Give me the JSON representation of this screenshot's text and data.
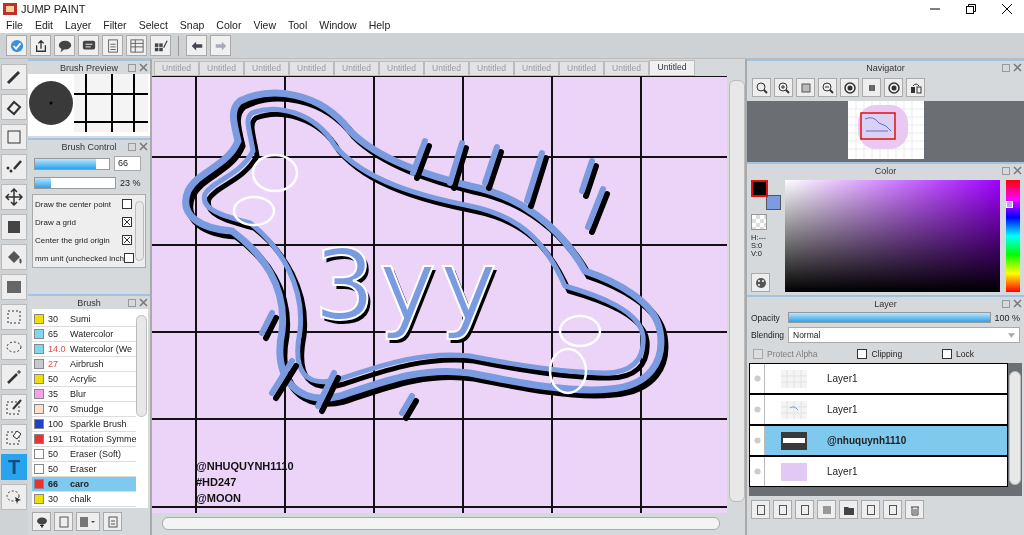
{
  "window": {
    "title": "JUMP PAINT"
  },
  "menu": [
    "File",
    "Edit",
    "Layer",
    "Filter",
    "Select",
    "Snap",
    "Color",
    "View",
    "Tool",
    "Window",
    "Help"
  ],
  "toolbar": [
    {
      "kind": "cloud"
    },
    {
      "kind": "share"
    },
    {
      "kind": "bubble"
    },
    {
      "kind": "comment"
    },
    {
      "kind": "page"
    },
    {
      "kind": "list"
    },
    {
      "kind": "grid"
    },
    {
      "kind": "undo"
    },
    {
      "kind": "redo"
    }
  ],
  "tools": [
    {
      "kind": "brush",
      "selected": false
    },
    {
      "kind": "eraser",
      "selected": false
    },
    {
      "kind": "square",
      "selected": false
    },
    {
      "kind": "dotpen",
      "selected": false
    },
    {
      "kind": "move",
      "selected": false
    },
    {
      "kind": "fill",
      "selected": false
    },
    {
      "kind": "bucket",
      "selected": false
    },
    {
      "kind": "gradient",
      "selected": false
    },
    {
      "kind": "rectselect",
      "selected": false
    },
    {
      "kind": "lasso",
      "selected": false
    },
    {
      "kind": "wand",
      "selected": false
    },
    {
      "kind": "selpen",
      "selected": false
    },
    {
      "kind": "selerase",
      "selected": false
    },
    {
      "kind": "text",
      "label": "T",
      "selected": true
    },
    {
      "kind": "pointer",
      "selected": false
    }
  ],
  "brush_preview": {
    "title": "Brush Preview"
  },
  "brush_control": {
    "title": "Brush Control",
    "size": {
      "level": 0.82,
      "value": "66"
    },
    "opacity": {
      "level": 0.2,
      "reading": "23 %"
    },
    "options": [
      {
        "label": "Draw the center point",
        "checked": false
      },
      {
        "label": "Draw a grid",
        "checked": true
      },
      {
        "label": "Center the grid origin",
        "checked": true
      },
      {
        "label": "mm unit (unchecked inch",
        "checked": false
      }
    ]
  },
  "brush_panel": {
    "title": "Brush",
    "brushes": [
      {
        "color": "#f0e000",
        "size": "30",
        "name": "Sumi",
        "flagged": false,
        "selected": false
      },
      {
        "color": "#7fd8f0",
        "size": "65",
        "name": "Watercolor",
        "flagged": false,
        "selected": false
      },
      {
        "color": "#7fd8f0",
        "size": "14.0",
        "name": "Watercolor (We",
        "flagged": true,
        "selected": false
      },
      {
        "color": "#c8c8c8",
        "size": "27",
        "name": "Airbrush",
        "flagged": true,
        "selected": false
      },
      {
        "color": "#f0e000",
        "size": "50",
        "name": "Acrylic",
        "flagged": false,
        "selected": false
      },
      {
        "color": "#f5a0f0",
        "size": "35",
        "name": "Blur",
        "flagged": false,
        "selected": false
      },
      {
        "color": "#fde0cc",
        "size": "70",
        "name": "Smudge",
        "flagged": false,
        "selected": false
      },
      {
        "color": "#2040d0",
        "size": "100",
        "name": "Sparkle Brush",
        "flagged": false,
        "selected": false
      },
      {
        "color": "#f03030",
        "size": "191",
        "name": "Rotation Symme",
        "flagged": false,
        "selected": false
      },
      {
        "color": "#ffffff",
        "size": "50",
        "name": "Eraser (Soft)",
        "flagged": false,
        "selected": false
      },
      {
        "color": "#ffffff",
        "size": "50",
        "name": "Eraser",
        "flagged": false,
        "selected": false
      },
      {
        "color": "#f03030",
        "size": "66",
        "name": "caro",
        "flagged": false,
        "selected": true
      },
      {
        "color": "#f0e000",
        "size": "30",
        "name": "chalk",
        "flagged": false,
        "selected": false
      }
    ]
  },
  "document_tabs": [
    {
      "label": "Untitled",
      "selected": false
    },
    {
      "label": "Untitled",
      "selected": false
    },
    {
      "label": "Untitled",
      "selected": false
    },
    {
      "label": "Untitled",
      "selected": false
    },
    {
      "label": "Untitled",
      "selected": false
    },
    {
      "label": "Untitled",
      "selected": false
    },
    {
      "label": "Untitled",
      "selected": false
    },
    {
      "label": "Untitled",
      "selected": false
    },
    {
      "label": "Untitled",
      "selected": false
    },
    {
      "label": "Untitled",
      "selected": false
    },
    {
      "label": "Untitled",
      "selected": false
    },
    {
      "label": "Untitled",
      "selected": true
    }
  ],
  "canvas": {
    "lettering": "3yy",
    "credits": [
      "@NHUQUYNH1110",
      "#HD247",
      "@MOON"
    ]
  },
  "navigator": {
    "title": "Navigator"
  },
  "color_panel": {
    "title": "Color",
    "swatches": [
      {
        "kind": "foreground",
        "color": "#000000"
      },
      {
        "kind": "background",
        "color": "#7d9be0"
      }
    ],
    "hue": {
      "level": 0.8
    },
    "hsv": [
      "H:---",
      "S:0",
      "V:0"
    ]
  },
  "layer_panel": {
    "title": "Layer",
    "opacity": {
      "label": "Opacity",
      "level": 1,
      "reading": "100 %"
    },
    "blending": {
      "label": "Blending",
      "value": "Normal"
    },
    "options": [
      {
        "label": "Protect Alpha",
        "checked": false,
        "disabled": true
      },
      {
        "label": "Clipping",
        "checked": false,
        "disabled": false
      },
      {
        "label": "Lock",
        "checked": false,
        "disabled": false
      }
    ],
    "layers": [
      {
        "name": "Layer1",
        "kind": "empty",
        "selected": false
      },
      {
        "name": "Layer1",
        "kind": "sketch",
        "selected": false
      },
      {
        "name": "@nhuquynh1110",
        "kind": "banner",
        "selected": true
      },
      {
        "name": "Layer1",
        "kind": "fill",
        "selected": false
      }
    ]
  }
}
